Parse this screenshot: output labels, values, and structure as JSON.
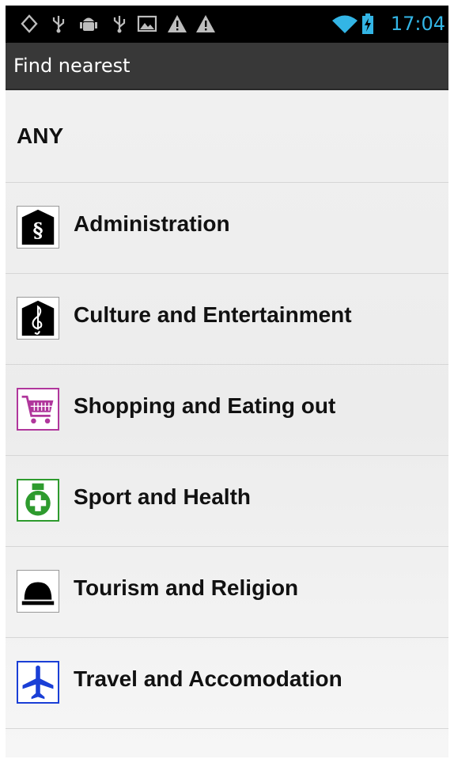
{
  "status_bar": {
    "icons": [
      "gps-icon",
      "usb-icon",
      "android-debug-icon",
      "usb-icon",
      "image-icon",
      "warning-icon",
      "warning-icon",
      "wifi-icon",
      "battery-charging-icon"
    ],
    "time": "17:04",
    "time_color": "#33b5e5"
  },
  "action_bar": {
    "title": "Find nearest"
  },
  "categories": [
    {
      "label": "ANY"
    },
    {
      "label": "Administration",
      "icon": "paragraph-sign-icon",
      "icon_color": "#000000"
    },
    {
      "label": "Culture and Entertainment",
      "icon": "treble-clef-icon",
      "icon_color": "#000000"
    },
    {
      "label": "Shopping and Eating out",
      "icon": "shopping-cart-icon",
      "icon_color": "#b0379c"
    },
    {
      "label": "Sport and Health",
      "icon": "medical-cross-icon",
      "icon_color": "#2e9b2e"
    },
    {
      "label": "Tourism and Religion",
      "icon": "bell-icon",
      "icon_color": "#000000"
    },
    {
      "label": "Travel and Accomodation",
      "icon": "airplane-icon",
      "icon_color": "#1a3fd6"
    }
  ]
}
